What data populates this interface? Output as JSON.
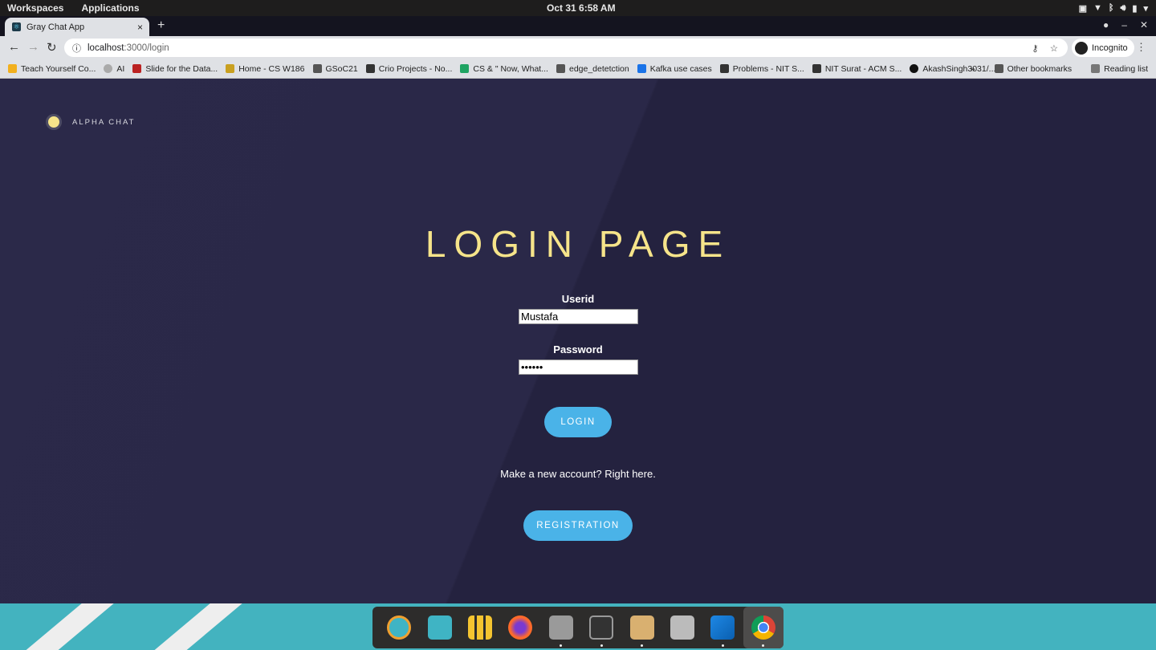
{
  "system_bar": {
    "workspaces": "Workspaces",
    "applications": "Applications",
    "clock": "Oct 31   6:58 AM"
  },
  "browser": {
    "tab_title": "Gray Chat App",
    "tab_close": "×",
    "new_tab": "+",
    "url_host": "localhost",
    "url_path": ":3000/login",
    "incognito": "Incognito",
    "bookmarks": [
      "Teach Yourself Co...",
      "AI",
      "Slide for the Data...",
      "Home - CS W186",
      "GSoC21",
      "Crio Projects - No...",
      "CS & \" Now, What...",
      "edge_detetction",
      "Kafka use cases",
      "Problems - NIT S...",
      "NIT Surat - ACM S...",
      "AkashSingh3031/..."
    ],
    "bookmarks_overflow": "»",
    "other_bookmarks": "Other bookmarks",
    "reading_list": "Reading list"
  },
  "page": {
    "brand": "ALPHA CHAT",
    "title": "LOGIN PAGE",
    "userid_label": "Userid",
    "userid_value": "Mustafa",
    "password_label": "Password",
    "password_value": "aaaaaa",
    "login_button": "LOGIN",
    "hint": "Make a new account? Right here.",
    "registration_button": "REGISTRATION",
    "accent_color": "#f6e48a",
    "button_color": "#4ab3e8"
  },
  "dock": {
    "apps": [
      "search-app",
      "workspace-app",
      "app-grid",
      "firefox",
      "files",
      "terminal",
      "archive",
      "settings",
      "vscode",
      "chrome"
    ]
  }
}
